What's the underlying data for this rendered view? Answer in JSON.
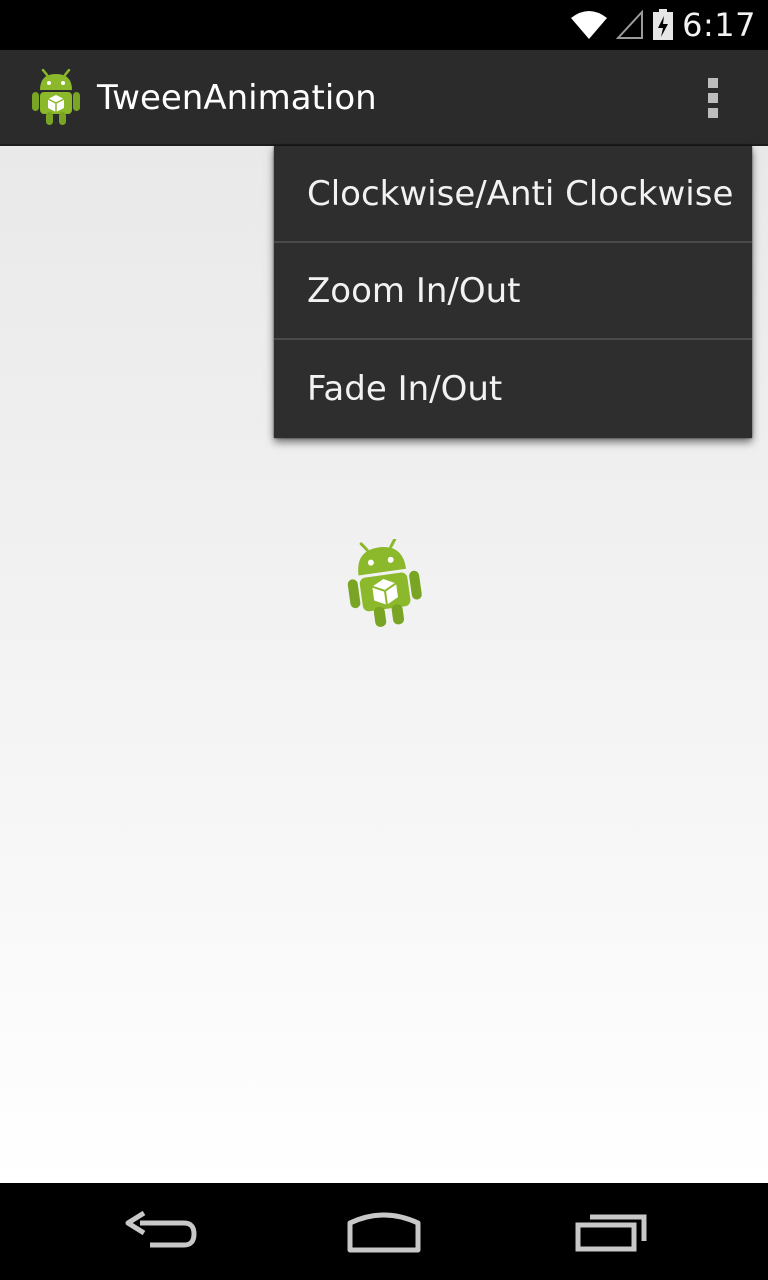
{
  "status_bar": {
    "time": "6:17",
    "wifi_icon": "wifi-icon",
    "signal_icon": "cell-signal-icon",
    "battery_icon": "battery-charging-icon"
  },
  "action_bar": {
    "app_icon": "android-app-icon",
    "title": "TweenAnimation",
    "overflow_icon": "overflow-menu-icon"
  },
  "menu": {
    "items": [
      {
        "label": "Clockwise/Anti Clockwise"
      },
      {
        "label": "Zoom In/Out"
      },
      {
        "label": "Fade In/Out"
      }
    ]
  },
  "content": {
    "image_icon": "android-robot-icon"
  },
  "nav_bar": {
    "back_icon": "back-icon",
    "home_icon": "home-icon",
    "recents_icon": "recent-apps-icon"
  },
  "colors": {
    "action_bar": "#2b2b2b",
    "menu_background": "#2e2e2e",
    "menu_divider": "#4a4a4a",
    "android_green": "#8cb82b"
  }
}
